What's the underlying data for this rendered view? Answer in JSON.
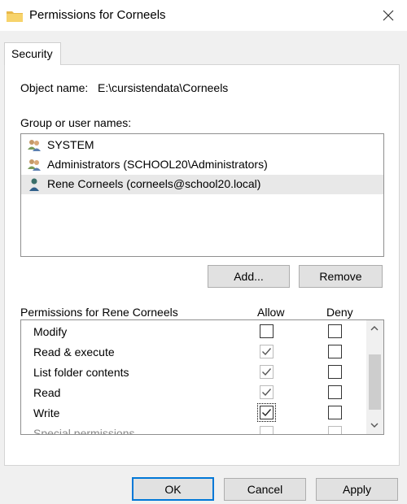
{
  "window": {
    "title": "Permissions for Corneels"
  },
  "tabs": [
    {
      "label": "Security"
    }
  ],
  "object": {
    "label": "Object name:",
    "value": "E:\\cursistendata\\Corneels"
  },
  "groups": {
    "label": "Group or user names:",
    "items": [
      {
        "label": "SYSTEM",
        "icon": "group-users-icon"
      },
      {
        "label": "Administrators (SCHOOL20\\Administrators)",
        "icon": "group-users-icon"
      },
      {
        "label": "Rene Corneels (corneels@school20.local)",
        "icon": "user-icon",
        "selected": true
      }
    ]
  },
  "buttons": {
    "add": "Add...",
    "remove": "Remove",
    "ok": "OK",
    "cancel": "Cancel",
    "apply": "Apply"
  },
  "permissions": {
    "label": "Permissions for Rene Corneels",
    "allow_header": "Allow",
    "deny_header": "Deny",
    "rows": [
      {
        "label": "Modify",
        "allow": false,
        "deny": false
      },
      {
        "label": "Read & execute",
        "allow": true,
        "deny": false
      },
      {
        "label": "List folder contents",
        "allow": true,
        "deny": false
      },
      {
        "label": "Read",
        "allow": true,
        "deny": false
      },
      {
        "label": "Write",
        "allow": true,
        "deny": false
      },
      {
        "label": "Special permissions",
        "allow": false,
        "deny": false
      }
    ]
  },
  "colors": {
    "accent": "#0078d7",
    "selection": "#e8e8e8"
  }
}
